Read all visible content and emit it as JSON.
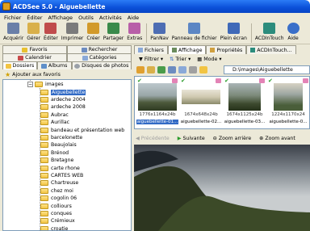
{
  "window": {
    "title": "ACDSee 5.0 - Aiguebellette"
  },
  "menu": [
    "Fichier",
    "Éditer",
    "Affichage",
    "Outils",
    "Activités",
    "Aide"
  ],
  "toolbar": [
    {
      "label": "Acquérir",
      "icon": "scanner-icon",
      "color": "#6a7fa8"
    },
    {
      "label": "Gérer",
      "icon": "folder-manage-icon",
      "color": "#d9b04a"
    },
    {
      "label": "Éditer",
      "icon": "edit-brush-icon",
      "color": "#c04c4c"
    },
    {
      "label": "Imprimer",
      "icon": "printer-icon",
      "color": "#7b7b7b"
    },
    {
      "label": "Créer",
      "icon": "create-wand-icon",
      "color": "#d29a2a"
    },
    {
      "label": "Partager",
      "icon": "share-icon",
      "color": "#3a8a4a"
    },
    {
      "label": "Extras",
      "icon": "extras-icon",
      "color": "#b85fa8"
    },
    {
      "label": "PanNav",
      "icon": "pannav-icon",
      "color": "#4d6db3"
    },
    {
      "label": "Panneau de fichier",
      "icon": "file-pane-icon",
      "color": "#5c86c4"
    },
    {
      "label": "Plein écran",
      "icon": "fullscreen-icon",
      "color": "#3f69b8"
    },
    {
      "label": "ACDInTouch",
      "icon": "acdintouch-icon",
      "color": "#2c8c7c"
    },
    {
      "label": "Aide",
      "icon": "help-icon",
      "color": "#3a6fc9"
    }
  ],
  "left_tabs": {
    "row1": [
      {
        "label": "Favoris",
        "icon": "favorites-icon"
      },
      {
        "label": "Rechercher",
        "icon": "search-icon"
      }
    ],
    "row2": [
      {
        "label": "Calendrier",
        "icon": "calendar-icon"
      },
      {
        "label": "Catégories",
        "icon": "categories-icon"
      }
    ],
    "row3": [
      {
        "label": "Dossiers",
        "icon": "folders-icon"
      },
      {
        "label": "Albums",
        "icon": "albums-icon"
      },
      {
        "label": "Disques de photos",
        "icon": "photo-discs-icon"
      }
    ]
  },
  "add_favorites": "Ajouter aux favoris",
  "tree": {
    "root": "images",
    "items": [
      "Aiguebellette",
      "ardeche 2004",
      "ardeche 2008",
      "Aubrac",
      "Aurillac",
      "bandeau et présentation web",
      "barcelonette",
      "Beaujolais",
      "Brénod",
      "Bretagne",
      "carte rhone",
      "CARTES WEB",
      "Chartreuse",
      "chez moi",
      "cogolin 06",
      "colliours",
      "conques",
      "Crémieux",
      "croatie"
    ],
    "selected": "Aiguebellette"
  },
  "right_tabs": [
    {
      "label": "Fichiers",
      "icon": "files-icon"
    },
    {
      "label": "Affichage",
      "icon": "view-icon"
    },
    {
      "label": "Propriétés",
      "icon": "properties-icon"
    },
    {
      "label": "ACDInTouch...",
      "icon": "acdintouch-tab-icon"
    }
  ],
  "file_toolbar": [
    {
      "label": "Filtrer",
      "icon": "filter-icon"
    },
    {
      "label": "Trier",
      "icon": "sort-icon"
    },
    {
      "label": "Mode",
      "icon": "mode-icon"
    }
  ],
  "path": "D:\\images\\Aiguebellette",
  "thumbnails": [
    {
      "dims": "1776x1164x24b",
      "name": "aiguebellette-01...",
      "selected": true
    },
    {
      "dims": "1674x648x24b",
      "name": "aiguebellette-02...",
      "selected": false
    },
    {
      "dims": "1674x1125x24b",
      "name": "aiguebellette-03...",
      "selected": false
    },
    {
      "dims": "1224x1170x24",
      "name": "aiguebellette-0...",
      "selected": false
    }
  ],
  "viewer": {
    "prev": "Précédente",
    "next": "Suivante",
    "zoom_out": "Zoom arrière",
    "zoom_in": "Zoom avant"
  }
}
